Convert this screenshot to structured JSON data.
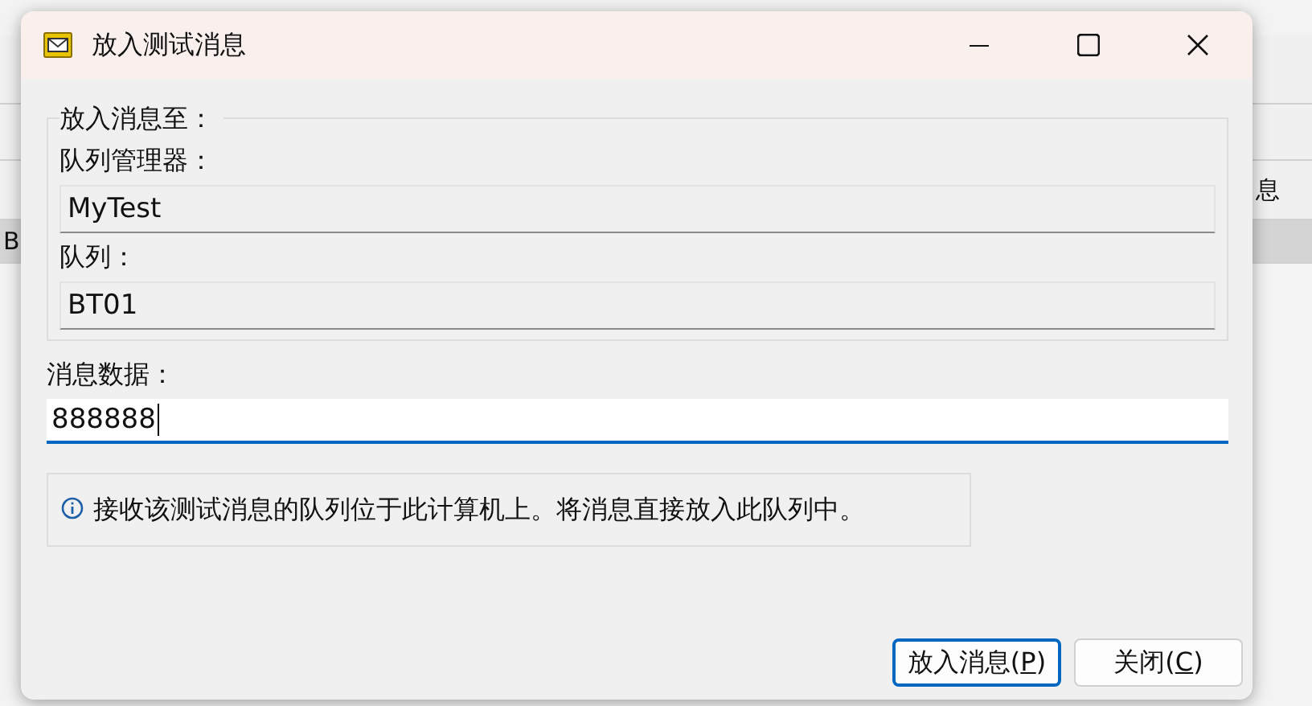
{
  "background": {
    "left": [
      {
        "kind": "heading"
      },
      {
        "kind": "filter"
      },
      {
        "kind": "header"
      },
      {
        "kind": "row",
        "text": "B",
        "selected": true
      }
    ],
    "right": [
      {
        "kind": "heading"
      },
      {
        "kind": "filter"
      },
      {
        "kind": "header",
        "text": "息"
      },
      {
        "kind": "row",
        "selected": true
      }
    ]
  },
  "dialog": {
    "title": "放入测试消息",
    "group": {
      "legend": "放入消息至：",
      "fields": [
        {
          "label": "队列管理器：",
          "value": "MyTest"
        },
        {
          "label": "队列：",
          "value": "BT01"
        }
      ]
    },
    "message": {
      "label": "消息数据：",
      "value": "888888"
    },
    "info": "接收该测试消息的队列位于此计算机上。将消息直接放入此队列中。",
    "buttons": [
      {
        "before": "放入消息(",
        "key": "P",
        "after": ")",
        "default": true
      },
      {
        "before": "关闭(",
        "key": "C",
        "after": ")",
        "default": false
      }
    ]
  }
}
